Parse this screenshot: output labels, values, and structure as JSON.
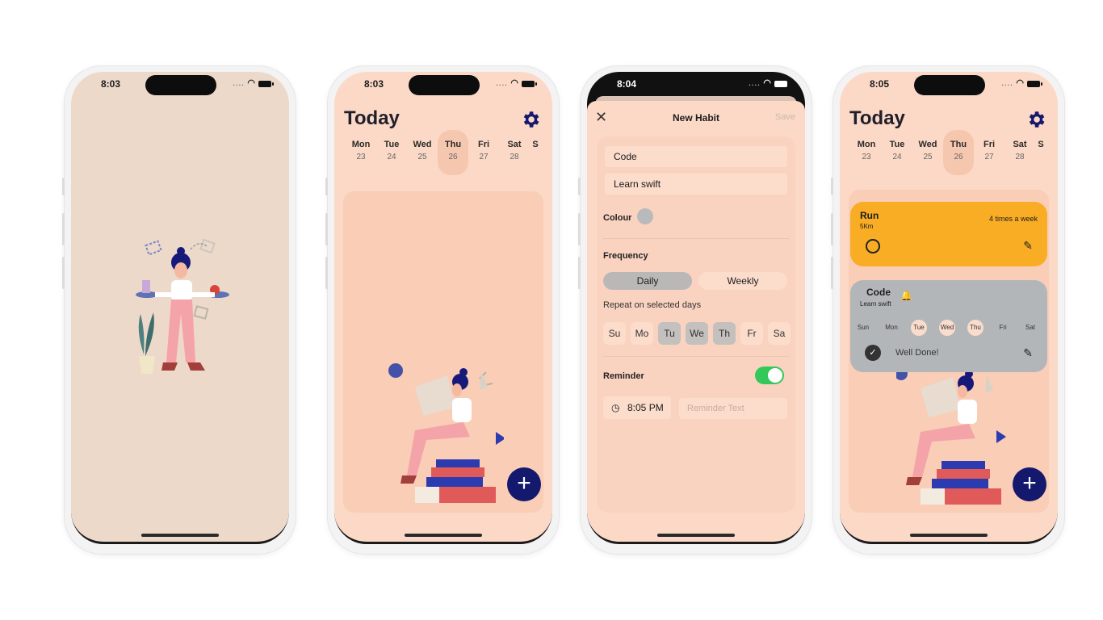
{
  "colors": {
    "peach": "#fcd9c6",
    "beige": "#edd9ca",
    "navy": "#14196d",
    "orange": "#f8ad25",
    "grey_card": "#b3b6b9",
    "toggle_green": "#34c759"
  },
  "phone1": {
    "time": "8:03"
  },
  "phone2": {
    "time": "8:03",
    "title": "Today",
    "days": [
      {
        "name": "Mon",
        "date": "23"
      },
      {
        "name": "Tue",
        "date": "24"
      },
      {
        "name": "Wed",
        "date": "25"
      },
      {
        "name": "Thu",
        "date": "26"
      },
      {
        "name": "Fri",
        "date": "27"
      },
      {
        "name": "Sat",
        "date": "28"
      },
      {
        "name": "S",
        "date": ""
      }
    ]
  },
  "phone3": {
    "time": "8:04",
    "header_title": "New Habit",
    "save_label": "Save",
    "name_value": "Code",
    "description_value": "Learn swift",
    "colour_label": "Colour",
    "frequency_label": "Frequency",
    "daily_label": "Daily",
    "weekly_label": "Weekly",
    "repeat_label": "Repeat on selected days",
    "weekdays": [
      "Su",
      "Mo",
      "Tu",
      "We",
      "Th",
      "Fr",
      "Sa"
    ],
    "reminder_label": "Reminder",
    "reminder_time": "8:05 PM",
    "reminder_text_placeholder": "Reminder Text"
  },
  "phone4": {
    "time": "8:05",
    "title": "Today",
    "days": [
      {
        "name": "Mon",
        "date": "23"
      },
      {
        "name": "Tue",
        "date": "24"
      },
      {
        "name": "Wed",
        "date": "25"
      },
      {
        "name": "Thu",
        "date": "26"
      },
      {
        "name": "Fri",
        "date": "27"
      },
      {
        "name": "Sat",
        "date": "28"
      },
      {
        "name": "S",
        "date": ""
      }
    ],
    "run_card": {
      "title": "Run",
      "subtitle": "5Km",
      "frequency": "4 times a week"
    },
    "code_card": {
      "title": "Code",
      "subtitle": "Learn swift",
      "weekdays": [
        "Sun",
        "Mon",
        "Tue",
        "Wed",
        "Thu",
        "Fri",
        "Sat"
      ],
      "done_text": "Well Done!"
    }
  }
}
